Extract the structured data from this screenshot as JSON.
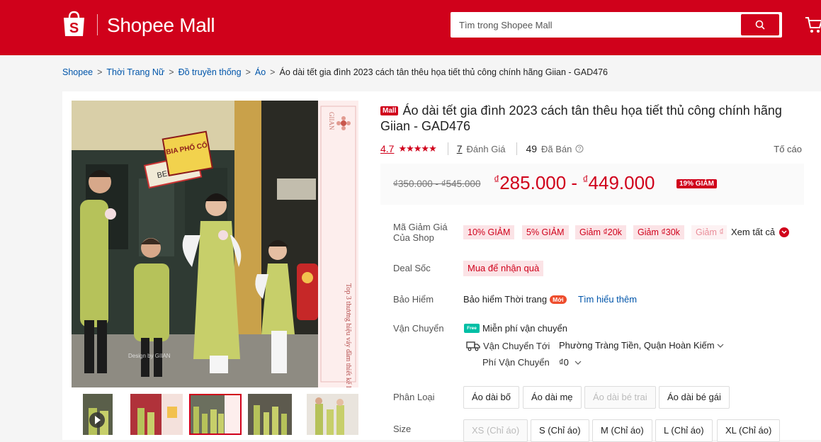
{
  "header": {
    "brand": "Shopee Mall",
    "search_placeholder": "Tìm trong Shopee Mall",
    "colors": {
      "brand_red": "#d0011b"
    }
  },
  "breadcrumb": {
    "items": [
      "Shopee",
      "Thời Trang Nữ",
      "Đồ truyền thống",
      "Áo"
    ],
    "current": "Áo dài tết gia đình 2023 cách tân thêu họa tiết thủ công chính hãng Giian - GAD476"
  },
  "gallery": {
    "image_texts": {
      "shop_sign": "BIA PHỐ CỔ",
      "beer_sign": "BEER 23",
      "brand_vertical": "GIIAN",
      "slogan": "Top 3 thương hiệu váy đầm thiết kế hàng đầu",
      "watermark": "Design by GIIAN"
    }
  },
  "product": {
    "mall_badge": "Mall",
    "title": "Áo dài tết gia đình 2023 cách tân thêu họa tiết thủ công chính hãng Giian - GAD476",
    "rating": "4.7",
    "stars": "★★★★★",
    "review_count": "7",
    "review_label": "Đánh Giá",
    "sold_count": "49",
    "sold_label": "Đã Bán",
    "report": "Tố cáo",
    "old_price": "₫350.000 - ₫545.000",
    "currency": "₫",
    "price_low": "285.000",
    "price_high": "449.000",
    "price_sep": " - ",
    "discount": "19% GIẢM"
  },
  "vouchers": {
    "label": "Mã Giảm Giá Của Shop",
    "items": [
      "10% GIẢM",
      "5% GIẢM",
      "Giảm ₫20k",
      "Giảm ₫30k",
      "Giảm ₫"
    ],
    "see_all": "Xem tất cả"
  },
  "deal": {
    "label": "Deal Sốc",
    "button": "Mua để nhận quà"
  },
  "insurance": {
    "label": "Bảo Hiểm",
    "text": "Bảo hiểm Thời trang",
    "badge": "Mới",
    "link": "Tìm hiểu thêm"
  },
  "shipping": {
    "label": "Vận Chuyển",
    "free_icon": "Free",
    "free": "Miễn phí vận chuyển",
    "to_label": "Vận Chuyển Tới",
    "location": "Phường Tràng Tiền, Quận Hoàn Kiếm",
    "fee_label": "Phí Vận Chuyển",
    "fee": "₫0"
  },
  "variants": {
    "label": "Phân Loại",
    "options": [
      "Áo dài bố",
      "Áo dài mẹ",
      "Áo dài bé trai",
      "Áo dài bé gái"
    ]
  },
  "sizes": {
    "label": "Size",
    "options": [
      "XS (Chỉ áo)",
      "S (Chỉ áo)",
      "M (Chỉ áo)",
      "L (Chỉ áo)",
      "XL (Chỉ áo)"
    ]
  }
}
